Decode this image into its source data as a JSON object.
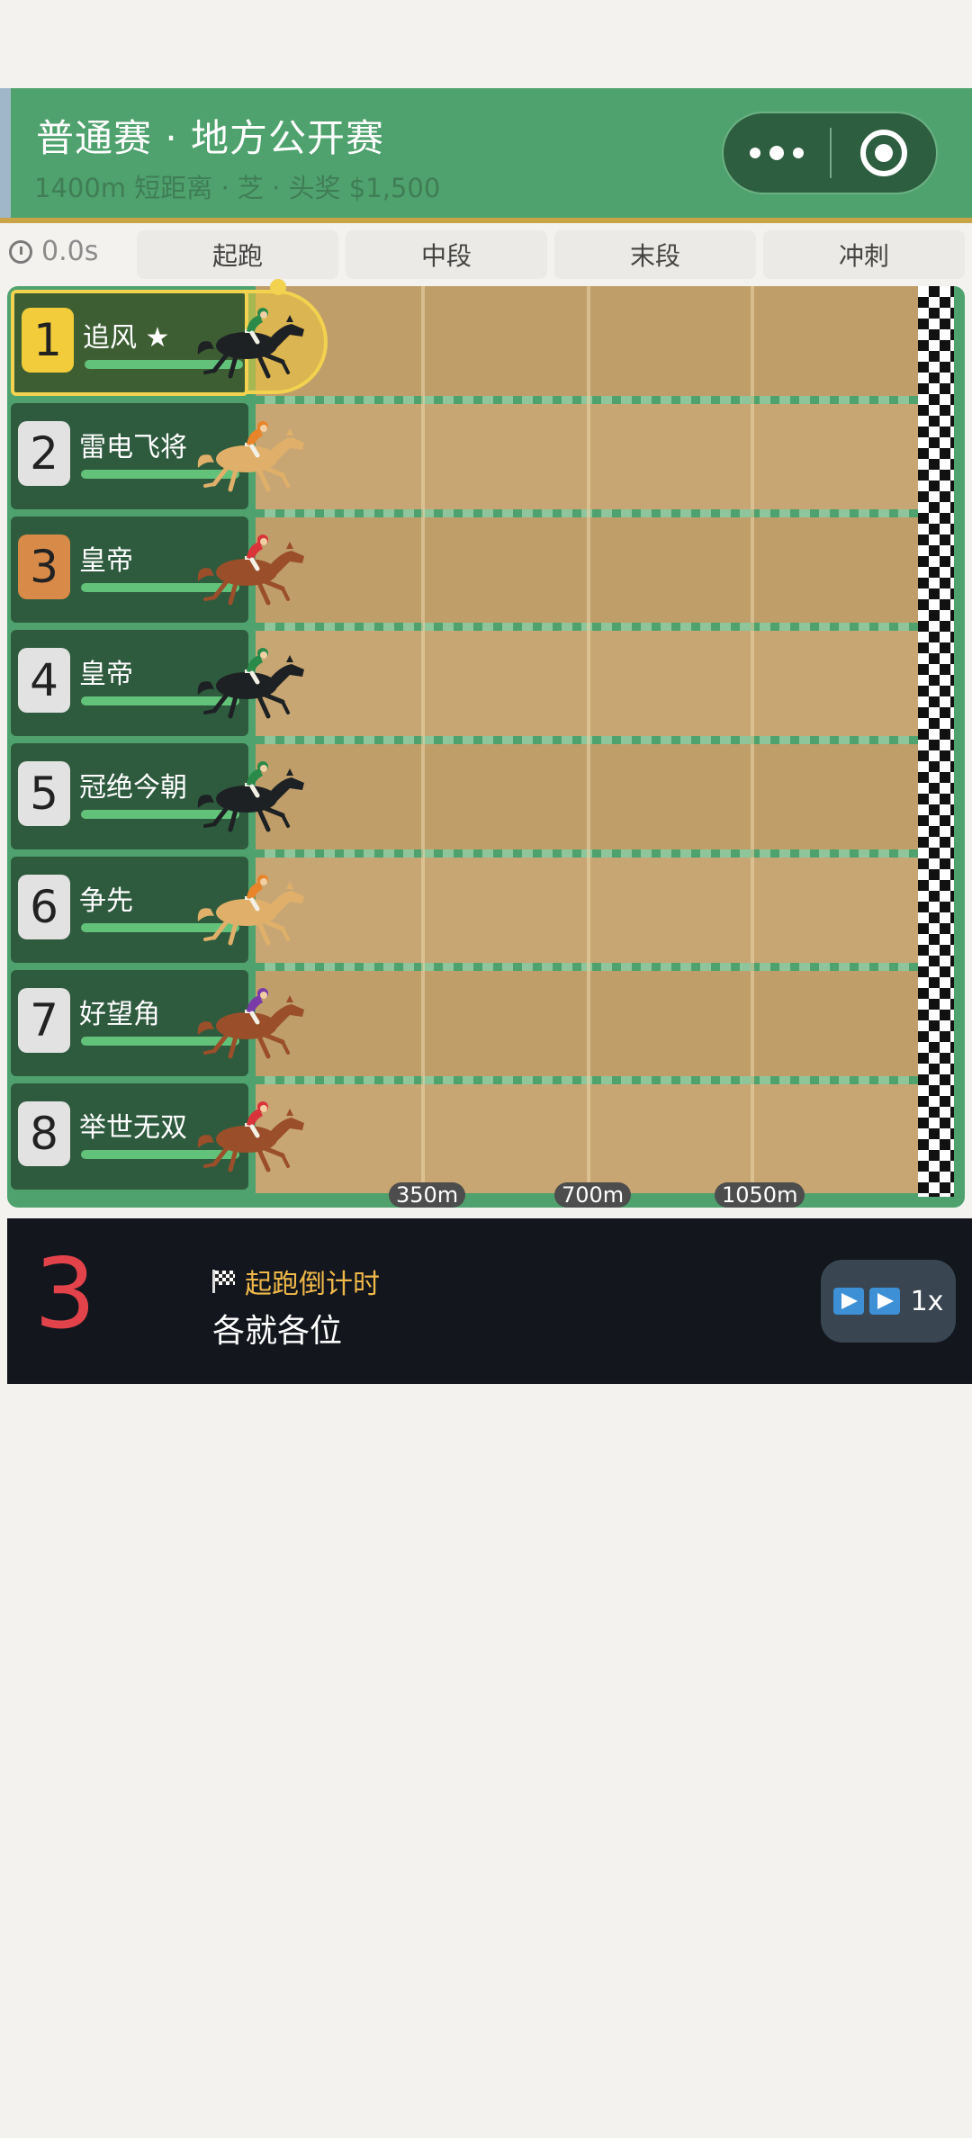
{
  "header": {
    "title": "普通赛 · 地方公开赛",
    "subtitle": "1400m 短距离 · 芝 · 头奖 $1,500"
  },
  "timer": "0.0s",
  "phases": [
    "起跑",
    "中段",
    "末段",
    "冲刺"
  ],
  "distance_markers": [
    "350m",
    "700m",
    "1050m"
  ],
  "lanes": [
    {
      "number": "1",
      "name": "追风 ★",
      "badge_color": "#f2cc3a",
      "horse_color": "#1e2124",
      "jockey_color": "#2a8a4a",
      "selected": true
    },
    {
      "number": "2",
      "name": "雷电飞将",
      "badge_color": "#e2e2e2",
      "horse_color": "#e0b06a",
      "jockey_color": "#e8842a",
      "selected": false
    },
    {
      "number": "3",
      "name": "皇帝",
      "badge_color": "#d88a48",
      "horse_color": "#9a4f2a",
      "jockey_color": "#d8343a",
      "selected": false
    },
    {
      "number": "4",
      "name": "皇帝",
      "badge_color": "#e2e2e2",
      "horse_color": "#1e2124",
      "jockey_color": "#2a8a4a",
      "selected": false
    },
    {
      "number": "5",
      "name": "冠绝今朝",
      "badge_color": "#e2e2e2",
      "horse_color": "#1e2124",
      "jockey_color": "#2a8a4a",
      "selected": false
    },
    {
      "number": "6",
      "name": "争先",
      "badge_color": "#e2e2e2",
      "horse_color": "#e0b06a",
      "jockey_color": "#e8842a",
      "selected": false
    },
    {
      "number": "7",
      "name": "好望角",
      "badge_color": "#e2e2e2",
      "horse_color": "#9a4f2a",
      "jockey_color": "#7a3aa8",
      "selected": false
    },
    {
      "number": "8",
      "name": "举世无双",
      "badge_color": "#e2e2e2",
      "horse_color": "#9a4f2a",
      "jockey_color": "#d8343a",
      "selected": false
    }
  ],
  "bottom": {
    "countdown": "3",
    "phase_label": "起跑倒计时",
    "message": "各就各位",
    "speed": "1x"
  },
  "colors": {
    "header_green": "#4fa26d",
    "turf_dark": "#bf9e6a",
    "turf_light": "#c8a673",
    "countdown_red": "#e2424a",
    "phase_orange": "#f0b94a"
  }
}
